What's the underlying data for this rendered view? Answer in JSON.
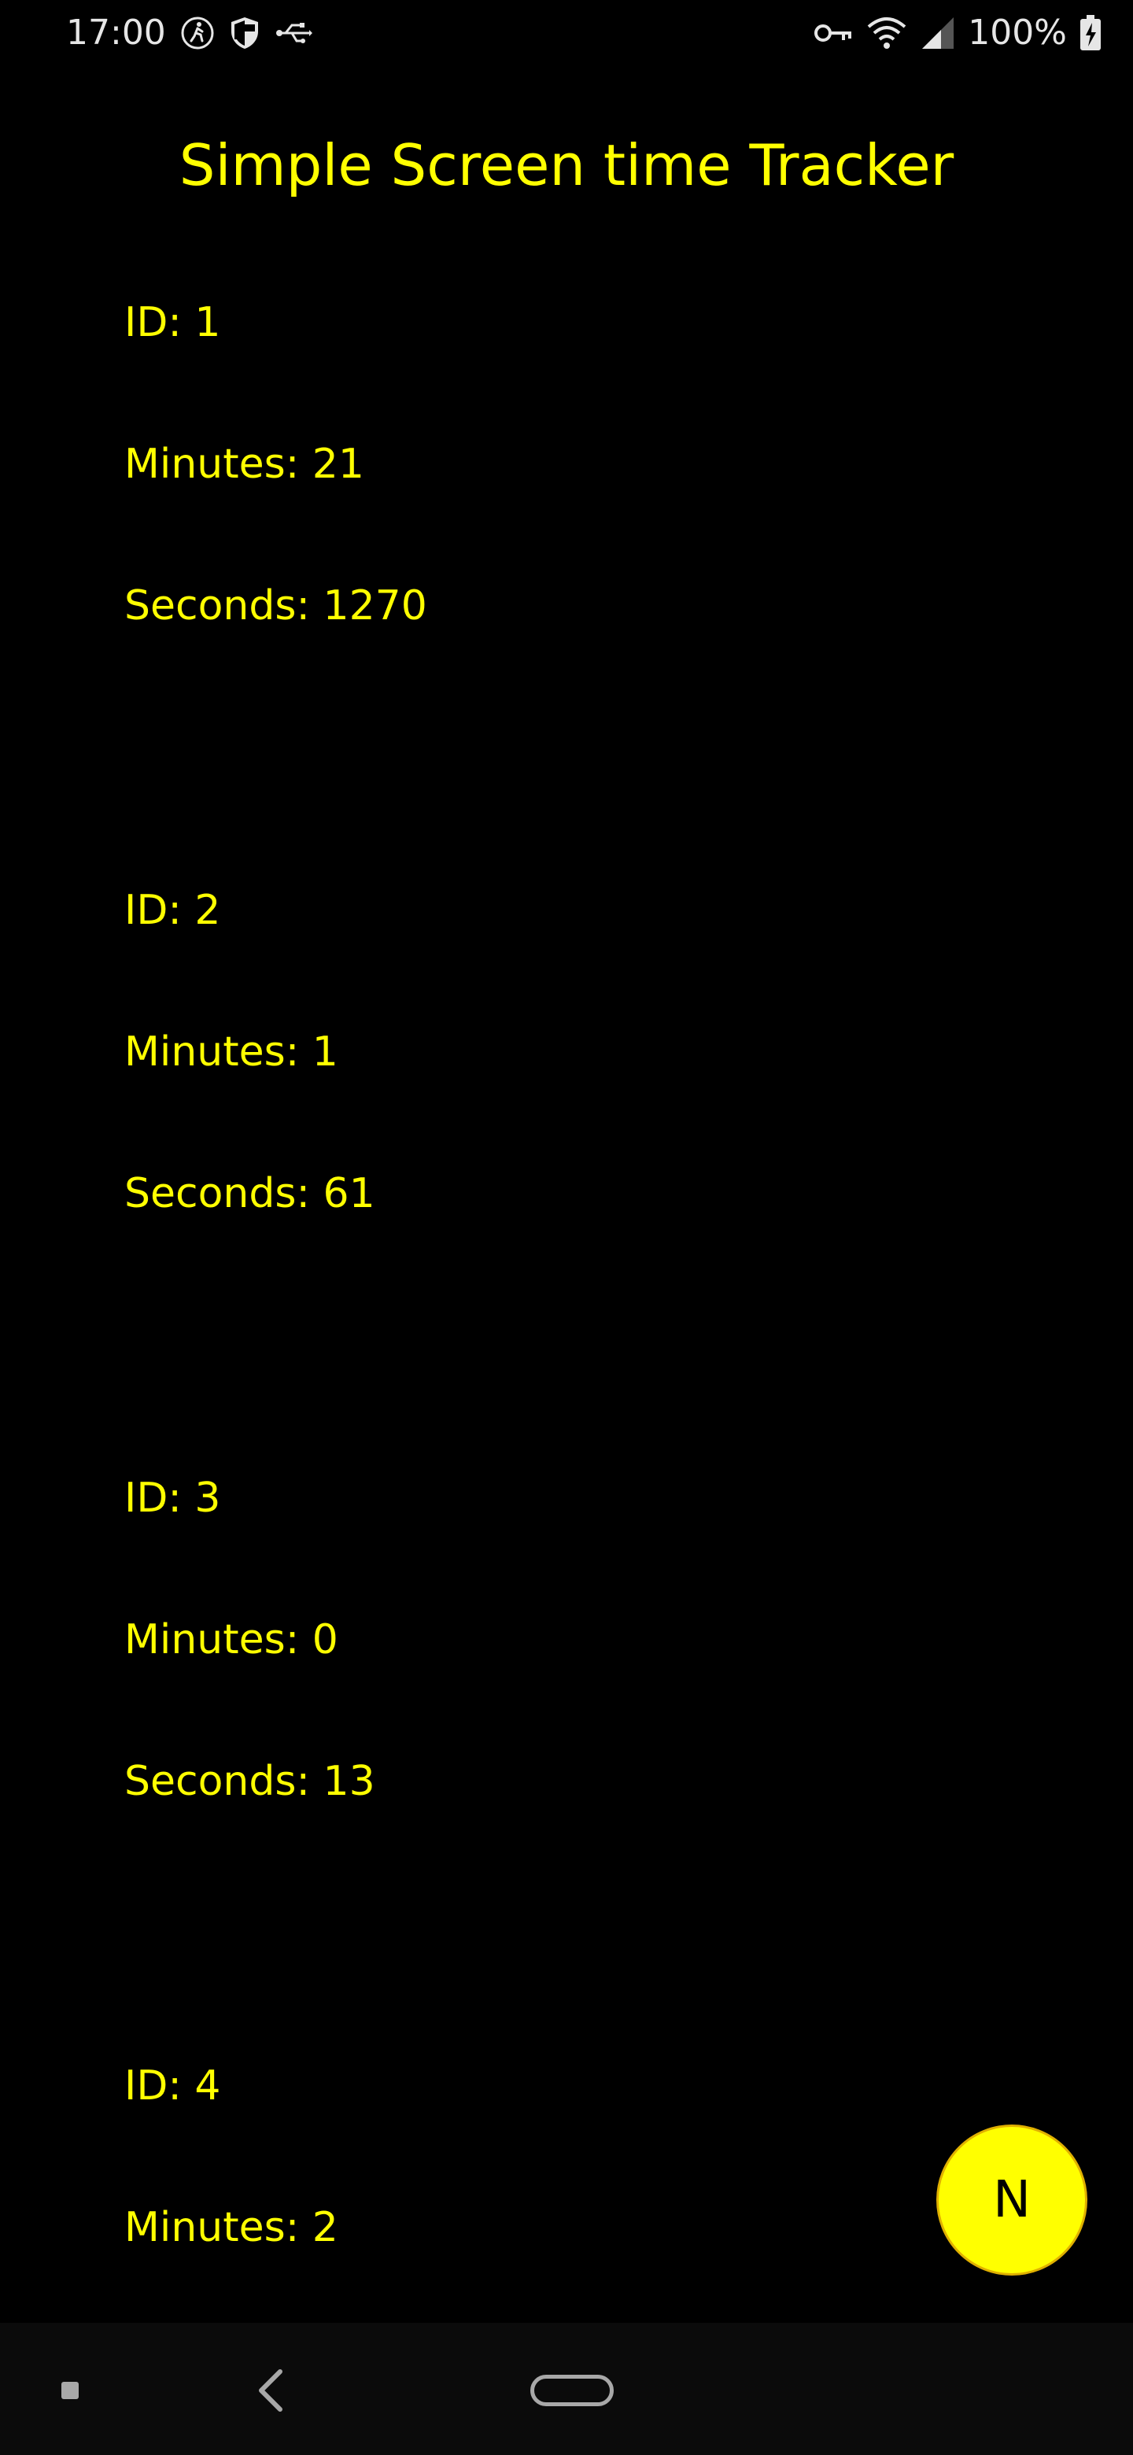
{
  "status_bar": {
    "time": "17:00",
    "battery": "100%",
    "icons_left": [
      "activity-icon",
      "shield-icon",
      "usb-icon"
    ],
    "icons_right": [
      "key-icon",
      "wifi-icon",
      "signal-icon",
      "battery-charging-icon"
    ]
  },
  "app": {
    "title": "Simple Screen time Tracker",
    "accent_color": "#ffff00",
    "background_color": "#000000"
  },
  "records": [
    {
      "id": "ID: 1",
      "minutes": "Minutes: 21",
      "seconds": "Seconds: 1270"
    },
    {
      "id": "ID: 2",
      "minutes": "Minutes: 1",
      "seconds": "Seconds: 61"
    },
    {
      "id": "ID: 3",
      "minutes": "Minutes: 0",
      "seconds": "Seconds: 13"
    },
    {
      "id": "ID: 4",
      "minutes": "Minutes: 2"
    }
  ],
  "fab": {
    "label": "N"
  },
  "nav_bar": {
    "icons": [
      "recents-icon",
      "back-icon",
      "home-pill-icon"
    ]
  }
}
